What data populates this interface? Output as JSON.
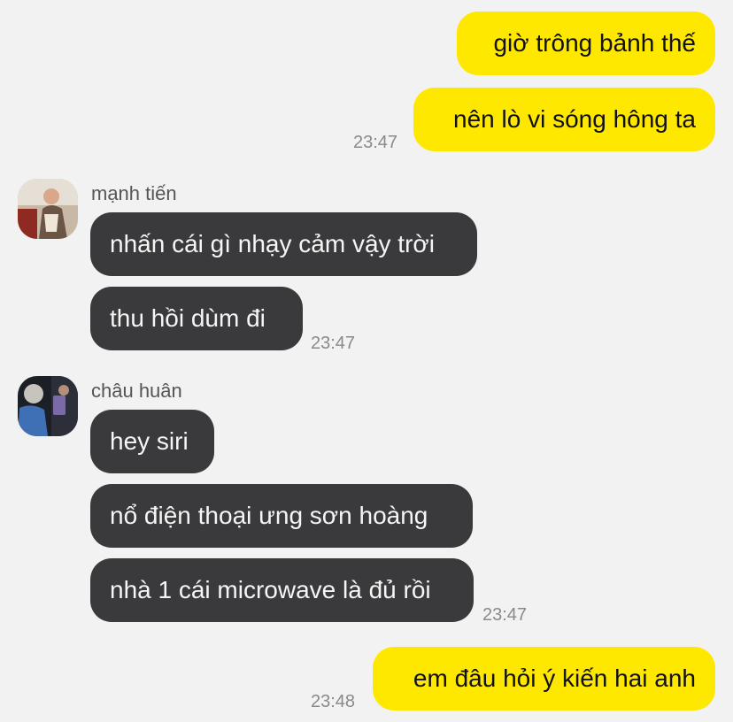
{
  "chat": {
    "outgoing_1": {
      "messages": [
        "giờ trông bảnh thế",
        "nên lò vi sóng hông ta"
      ],
      "time": "23:47"
    },
    "incoming_1": {
      "sender": "mạnh tiến",
      "messages": [
        "nhấn cái gì nhạy cảm vậy trời",
        "thu hồi dùm đi"
      ],
      "time": "23:47"
    },
    "incoming_2": {
      "sender": "châu huân",
      "messages": [
        "hey siri",
        "nổ điện thoại ưng sơn hoàng",
        "nhà 1 cái microwave là đủ rồi"
      ],
      "time": "23:47"
    },
    "outgoing_2": {
      "messages": [
        "em đâu hỏi ý kiến hai anh"
      ],
      "time": "23:48"
    }
  },
  "colors": {
    "background": "#f2f2f2",
    "outgoing_bubble": "#ffe800",
    "incoming_bubble": "#3a3a3c",
    "timestamp": "#8a8a8a"
  },
  "icons": {
    "avatar_1": "user-avatar-photo",
    "avatar_2": "user-avatar-photo"
  }
}
